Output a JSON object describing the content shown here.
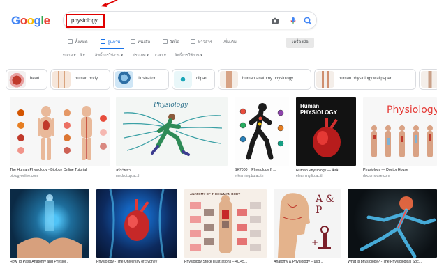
{
  "logo": "Google",
  "search": {
    "query": "physiology"
  },
  "tabs": [
    "ทั้งหมด",
    "รูปภาพ",
    "หนังสือ",
    "วิดีโอ",
    "ข่าวสาร",
    "เพิ่มเติม"
  ],
  "settings_label": "เครื่องมือ",
  "filters": [
    "ขนาด ▾",
    "สี ▾",
    "สิทธิ์การใช้งาน ▾",
    "ประเภท ▾",
    "เวลา ▾",
    "สิทธิ์การใช้งาน ▾"
  ],
  "chips": [
    "heart",
    "human body",
    "illustration",
    "clipart",
    "human anatomy physiology",
    "human physiology wallpaper"
  ],
  "results": [
    {
      "caption": "The Human Physiology - Biology Online Tutorial",
      "site": "biologyonline.com",
      "title": ""
    },
    {
      "caption": "สรีรวิทยา",
      "site": "medsci.up.ac.th",
      "title": "Physiology"
    },
    {
      "caption": "SK7000 : [Physiology I] ...",
      "site": "e-learning.bu.ac.th",
      "title": ""
    },
    {
      "caption": "Human Physiology — สิ่งพิ...",
      "site": "elearning.lib.ac.th",
      "title": "Human PHYSIOLOGY"
    },
    {
      "caption": "Physiology — Doctor House",
      "site": "doctorhouse.com",
      "title": "Physiology"
    },
    {
      "caption": "How To Pass Anatomy and Physiol...",
      "site": "",
      "title": ""
    },
    {
      "caption": "Physiology - The University of Sydney",
      "site": "",
      "title": ""
    },
    {
      "caption": "Physiology Stock Illustrations – 40,45...",
      "site": "",
      "title": "ANATOMY OF THE HUMAN BODY"
    },
    {
      "caption": "Anatomy & Physiology – usd...",
      "site": "",
      "title": "A & P"
    },
    {
      "caption": "What is physiology? - The Physiological Soc...",
      "site": "",
      "title": ""
    }
  ],
  "colors": {
    "google_blue": "#4285f4",
    "google_red": "#ea4335",
    "google_yellow": "#fbbc05",
    "google_green": "#34a853",
    "annotation_red": "#e00000",
    "link_blue": "#1a73e8"
  }
}
